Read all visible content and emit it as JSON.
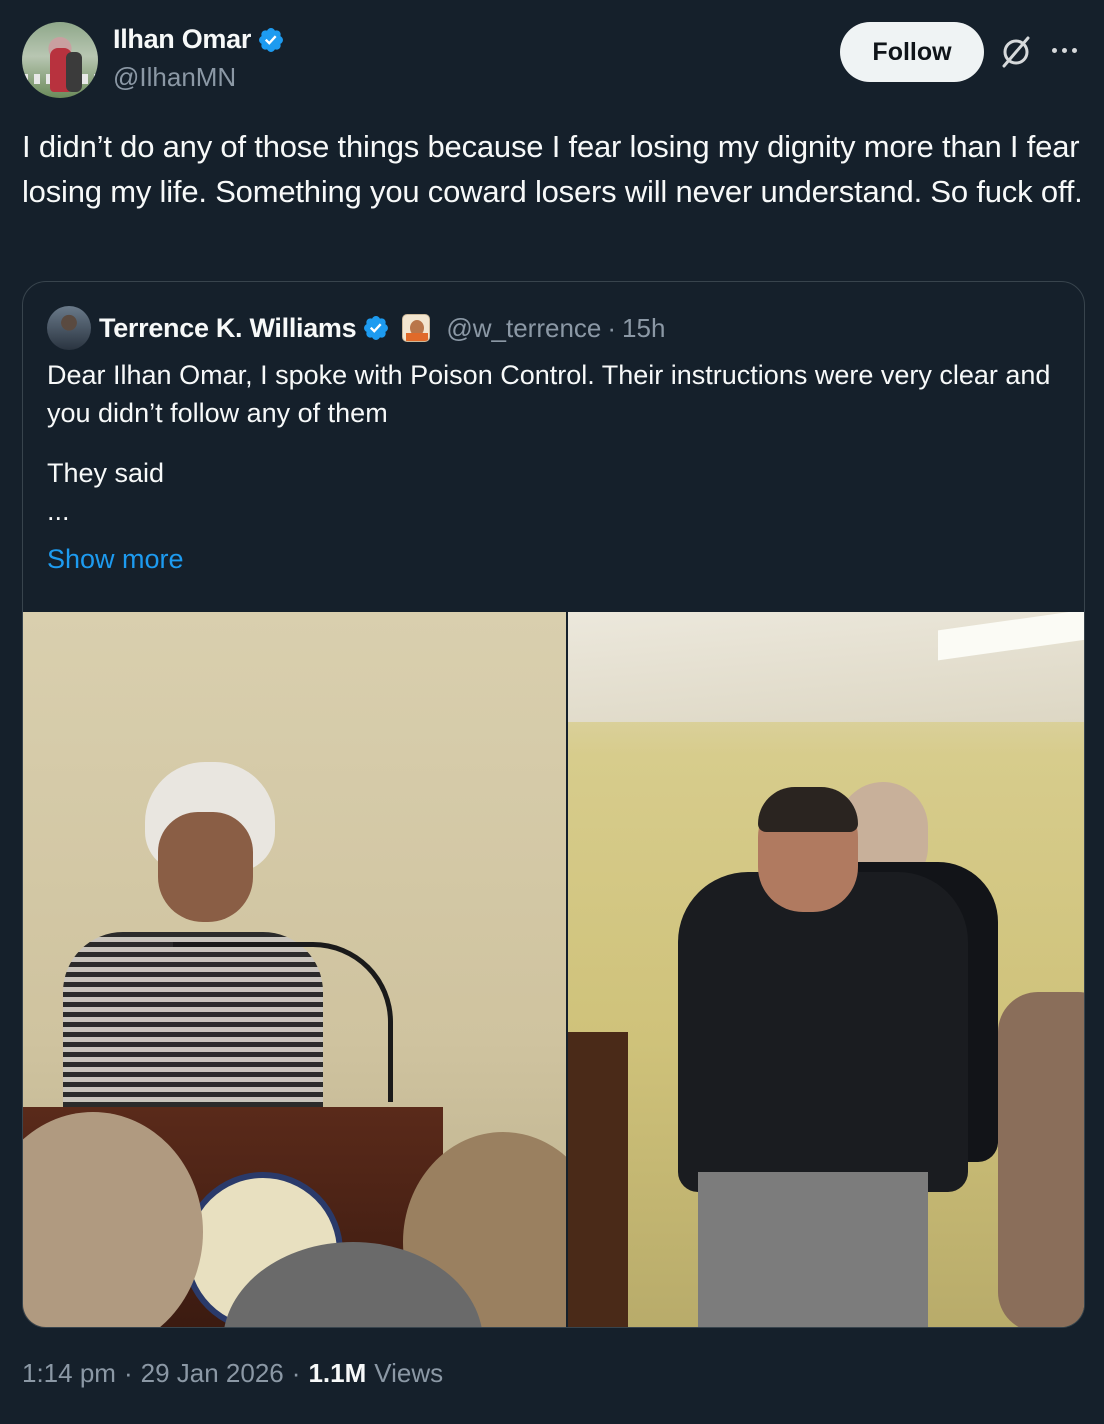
{
  "author": {
    "name": "Ilhan Omar",
    "handle": "@IlhanMN",
    "verified": true
  },
  "actions": {
    "follow_label": "Follow"
  },
  "tweet": {
    "text": "I didn’t do any of those things because I fear losing my dignity more than I fear losing my life. Something you coward losers will never understand. So fuck off."
  },
  "quoted": {
    "name": "Terrence K. Williams",
    "handle": "@w_terrence",
    "separator": "·",
    "time": "15h",
    "line1": "Dear Ilhan Omar,  I spoke with Poison Control. Their instructions were very clear and you didn’t follow any of them",
    "line2": "They said",
    "line3": "...",
    "show_more": "Show more"
  },
  "meta": {
    "time": "1:14 pm",
    "sep1": "·",
    "date": "29 Jan 2026",
    "sep2": "·",
    "views_count": "1.1M",
    "views_label": "Views"
  },
  "colors": {
    "background": "#15202b",
    "link": "#1d9bf0",
    "verified": "#1d9bf0",
    "muted": "#8b98a5"
  }
}
